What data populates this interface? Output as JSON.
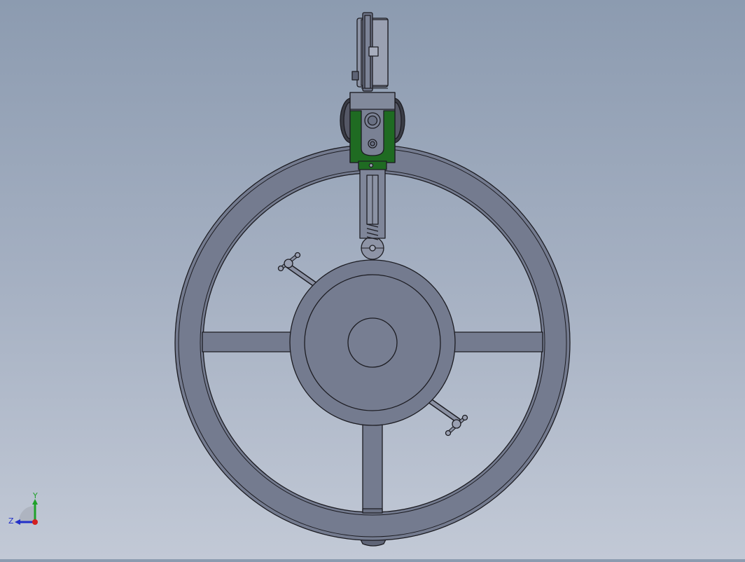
{
  "viewport": {
    "background_top": "#8c9bb0",
    "background_bottom": "#c2c9d6",
    "part_fill": "#747b8f",
    "part_edge": "#1c1c22",
    "clamp_color": "#1f6b22"
  },
  "triad": {
    "y_label": "Y",
    "z_label": "Z",
    "x_axis_color": "#d42020",
    "y_axis_color": "#1fa12a",
    "z_axis_color": "#2330c8"
  },
  "model": {
    "view": "front",
    "parts": [
      "dial-indicator",
      "green-clamp-bracket",
      "probe-stem",
      "ring-frame",
      "hub",
      "spokes",
      "thumb-screws"
    ]
  }
}
